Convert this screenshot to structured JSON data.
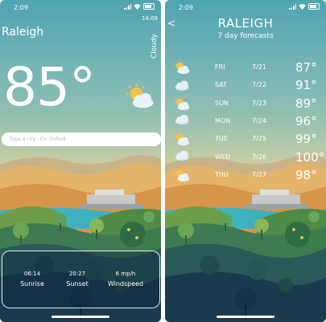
{
  "status_bar": {
    "time_left": "2:09",
    "time_right": "2:09"
  },
  "current": {
    "city": "Raleigh",
    "clock": "14:09",
    "condition": "Cloudy",
    "temperature": "85°",
    "search_placeholder": "Type a city : Ex: Oxford",
    "sunrise_value": "06:14",
    "sunrise_label": "Sunrise",
    "sunset_value": "20:27",
    "sunset_label": "Sunset",
    "wind_value": "6 mp/h",
    "wind_label": "Windspeed"
  },
  "forecast": {
    "back_label": "<",
    "city": "RALEIGH",
    "subtitle": "7 day forecasts",
    "days": [
      {
        "day": "FRI",
        "date": "7/21",
        "temp": "87°",
        "icon": "sun-cloud-icon"
      },
      {
        "day": "SAT",
        "date": "7/22",
        "temp": "91°",
        "icon": "cloud-icon"
      },
      {
        "day": "SUN",
        "date": "7/23",
        "temp": "89°",
        "icon": "sun-cloud-icon"
      },
      {
        "day": "MON",
        "date": "7/24",
        "temp": "96°",
        "icon": "rain-cloud-icon"
      },
      {
        "day": "TUE",
        "date": "7/25",
        "temp": "99°",
        "icon": "sun-cloud-icon"
      },
      {
        "day": "WED",
        "date": "7/26",
        "temp": "100°",
        "icon": "rain-cloud-icon"
      },
      {
        "day": "THU",
        "date": "7/27",
        "temp": "98°",
        "icon": "sun-cloud-icon"
      }
    ]
  },
  "colors": {
    "sky_top": "#5aa9b4",
    "sky_bottom": "#d9cf9c",
    "hills_orange": "#e0a654",
    "water": "#3fb0c0",
    "forest_dark": "#1d3d52",
    "tree_green": "#5c9a4a"
  }
}
